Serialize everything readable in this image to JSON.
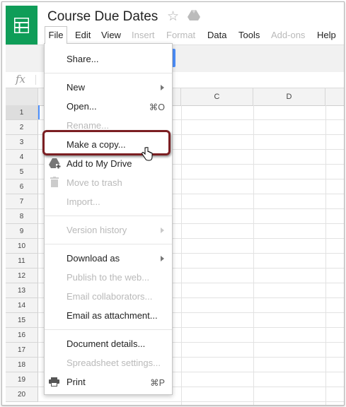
{
  "app": {
    "title": "Course Due Dates"
  },
  "menubar": [
    {
      "label": "File",
      "disabled": false
    },
    {
      "label": "Edit",
      "disabled": false
    },
    {
      "label": "View",
      "disabled": false
    },
    {
      "label": "Insert",
      "disabled": true
    },
    {
      "label": "Format",
      "disabled": true
    },
    {
      "label": "Data",
      "disabled": false
    },
    {
      "label": "Tools",
      "disabled": false
    },
    {
      "label": "Add-ons",
      "disabled": true
    },
    {
      "label": "Help",
      "disabled": false
    }
  ],
  "formula": {
    "icon": "fx"
  },
  "grid": {
    "columns": [
      "C",
      "D"
    ],
    "rows": [
      "1",
      "2",
      "3",
      "4",
      "5",
      "6",
      "7",
      "8",
      "9",
      "10",
      "11",
      "12",
      "13",
      "14",
      "15",
      "16",
      "17",
      "18",
      "19",
      "20"
    ]
  },
  "file_menu": {
    "items": [
      {
        "label": "Share...",
        "disabled": false
      },
      {
        "label": "New",
        "disabled": false,
        "submenu": true
      },
      {
        "label": "Open...",
        "disabled": false,
        "shortcut": "⌘O"
      },
      {
        "label": "Rename...",
        "disabled": true
      },
      {
        "label": "Make a copy...",
        "disabled": false,
        "highlighted": true
      },
      {
        "label": "Add to My Drive",
        "disabled": false,
        "icon": "drive-add-icon"
      },
      {
        "label": "Move to trash",
        "disabled": true,
        "icon": "trash-icon"
      },
      {
        "label": "Import...",
        "disabled": true
      },
      {
        "label": "Version history",
        "disabled": true,
        "submenu": true
      },
      {
        "label": "Download as",
        "disabled": false,
        "submenu": true
      },
      {
        "label": "Publish to the web...",
        "disabled": true
      },
      {
        "label": "Email collaborators...",
        "disabled": true
      },
      {
        "label": "Email as attachment...",
        "disabled": false
      },
      {
        "label": "Document details...",
        "disabled": false
      },
      {
        "label": "Spreadsheet settings...",
        "disabled": true
      },
      {
        "label": "Print",
        "disabled": false,
        "shortcut": "⌘P",
        "icon": "printer-icon"
      }
    ]
  },
  "colors": {
    "brand_green": "#0f9d58",
    "highlight_border": "#7b1e22",
    "accent_blue": "#4d90fe"
  }
}
